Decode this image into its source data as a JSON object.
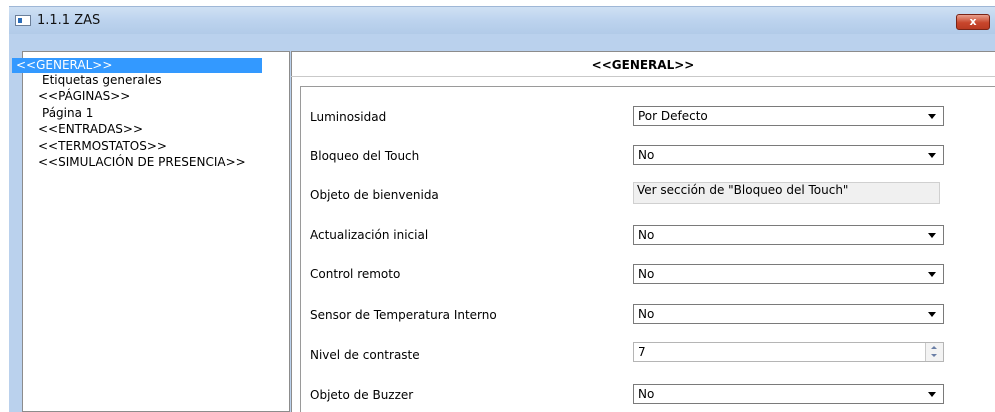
{
  "window": {
    "title": "1.1.1 ZAS",
    "close_label": "x"
  },
  "tree": {
    "items": [
      {
        "label": "<<GENERAL>>",
        "selected": true
      },
      {
        "label": "Etiquetas generales",
        "selected": false
      },
      {
        "label": "<<PÁGINAS>>",
        "selected": false
      },
      {
        "label": "Página 1",
        "selected": false
      },
      {
        "label": "<<ENTRADAS>>",
        "selected": false
      },
      {
        "label": "<<TERMOSTATOS>>",
        "selected": false
      },
      {
        "label": "<<SIMULACIÓN DE PRESENCIA>>",
        "selected": false
      }
    ]
  },
  "page": {
    "title": "<<GENERAL>>"
  },
  "params": [
    {
      "label": "Luminosidad",
      "type": "select",
      "value": "Por Defecto"
    },
    {
      "label": "Bloqueo del Touch",
      "type": "select",
      "value": "No"
    },
    {
      "label": "Objeto de bienvenida",
      "type": "readonly",
      "value": "Ver sección de \"Bloqueo del Touch\""
    },
    {
      "label": "Actualización inicial",
      "type": "select",
      "value": "No"
    },
    {
      "label": "Control remoto",
      "type": "select",
      "value": "No"
    },
    {
      "label": "Sensor de Temperatura Interno",
      "type": "select",
      "value": "No"
    },
    {
      "label": "Nivel de contraste",
      "type": "spin",
      "value": "7"
    },
    {
      "label": "Objeto de Buzzer",
      "type": "select",
      "value": "No"
    }
  ],
  "colors": {
    "selection": "#3399ff",
    "titlebar": "#bcd3ee",
    "close": "#c8462c"
  }
}
